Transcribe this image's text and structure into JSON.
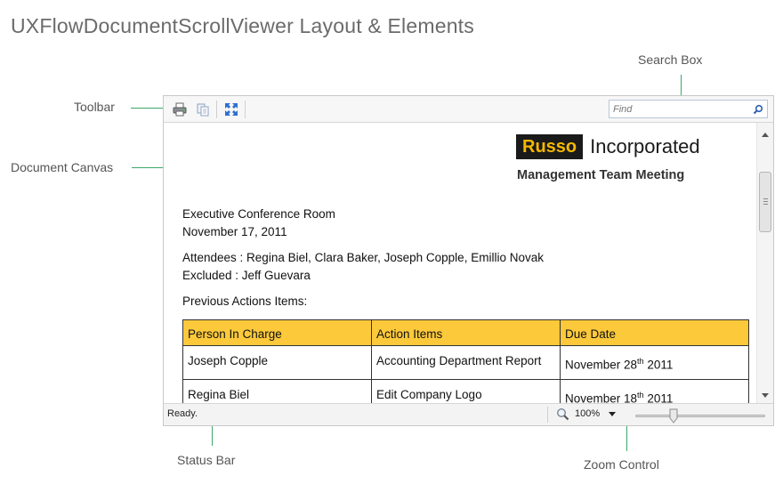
{
  "title": "UXFlowDocumentScrollViewer Layout & Elements",
  "callouts": {
    "toolbar": "Toolbar",
    "search_box": "Search Box",
    "document_canvas": "Document Canvas",
    "status_bar": "Status Bar",
    "zoom_control": "Zoom Control"
  },
  "toolbar": {
    "buttons": [
      "print-icon",
      "copy-icon",
      "fit-to-window-icon"
    ]
  },
  "search": {
    "placeholder": "Find",
    "value": ""
  },
  "document": {
    "logo_brand": "Russo",
    "logo_text": "Incorporated",
    "meeting_title": "Management Team Meeting",
    "location": "Executive Conference Room",
    "date": "November 17, 2011",
    "attendees": "Attendees : Regina Biel, Clara Baker, Joseph Copple, Emillio Novak",
    "excluded": "Excluded : Jeff Guevara",
    "previous_actions_heading": "Previous Actions Items:",
    "table": {
      "headers": [
        "Person In Charge",
        "Action Items",
        "Due Date"
      ],
      "rows": [
        {
          "person": "Joseph Copple",
          "action": "Accounting Department Report",
          "due": "November 28",
          "due_sup": "th",
          "due_year": " 2011"
        },
        {
          "person": "Regina Biel",
          "action": "Edit Company Logo",
          "due": "November 18",
          "due_sup": "th",
          "due_year": " 2011"
        }
      ]
    }
  },
  "status": {
    "text": "Ready."
  },
  "zoom": {
    "value": "100%",
    "level": 0.33
  },
  "colors": {
    "accent_line": "#3aa86a",
    "table_header": "#fcc93b",
    "logo_brand": "#f5b800"
  }
}
